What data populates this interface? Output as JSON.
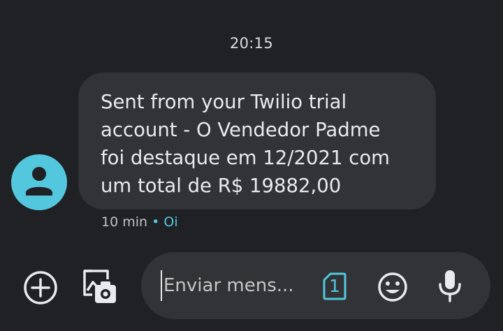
{
  "conversation": {
    "time_header": "20:15",
    "message": {
      "text": "Sent from your Twilio trial\naccount - O Vendedor Padme\nfoi destaque em 12/2021 com\num total de R$ 19882,00",
      "age": "10 min",
      "separator": "•",
      "status": "Oi"
    },
    "avatar_icon": "person-icon"
  },
  "composer": {
    "placeholder": "Enviar mens...",
    "sim_number": "1",
    "icons": [
      "add-circle-icon",
      "gallery-icon",
      "sim-card-icon",
      "emoji-icon",
      "microphone-icon"
    ]
  },
  "colors": {
    "background": "#202124",
    "bubble": "#323336",
    "accent": "#53c7dd",
    "text": "#e8eaed"
  }
}
